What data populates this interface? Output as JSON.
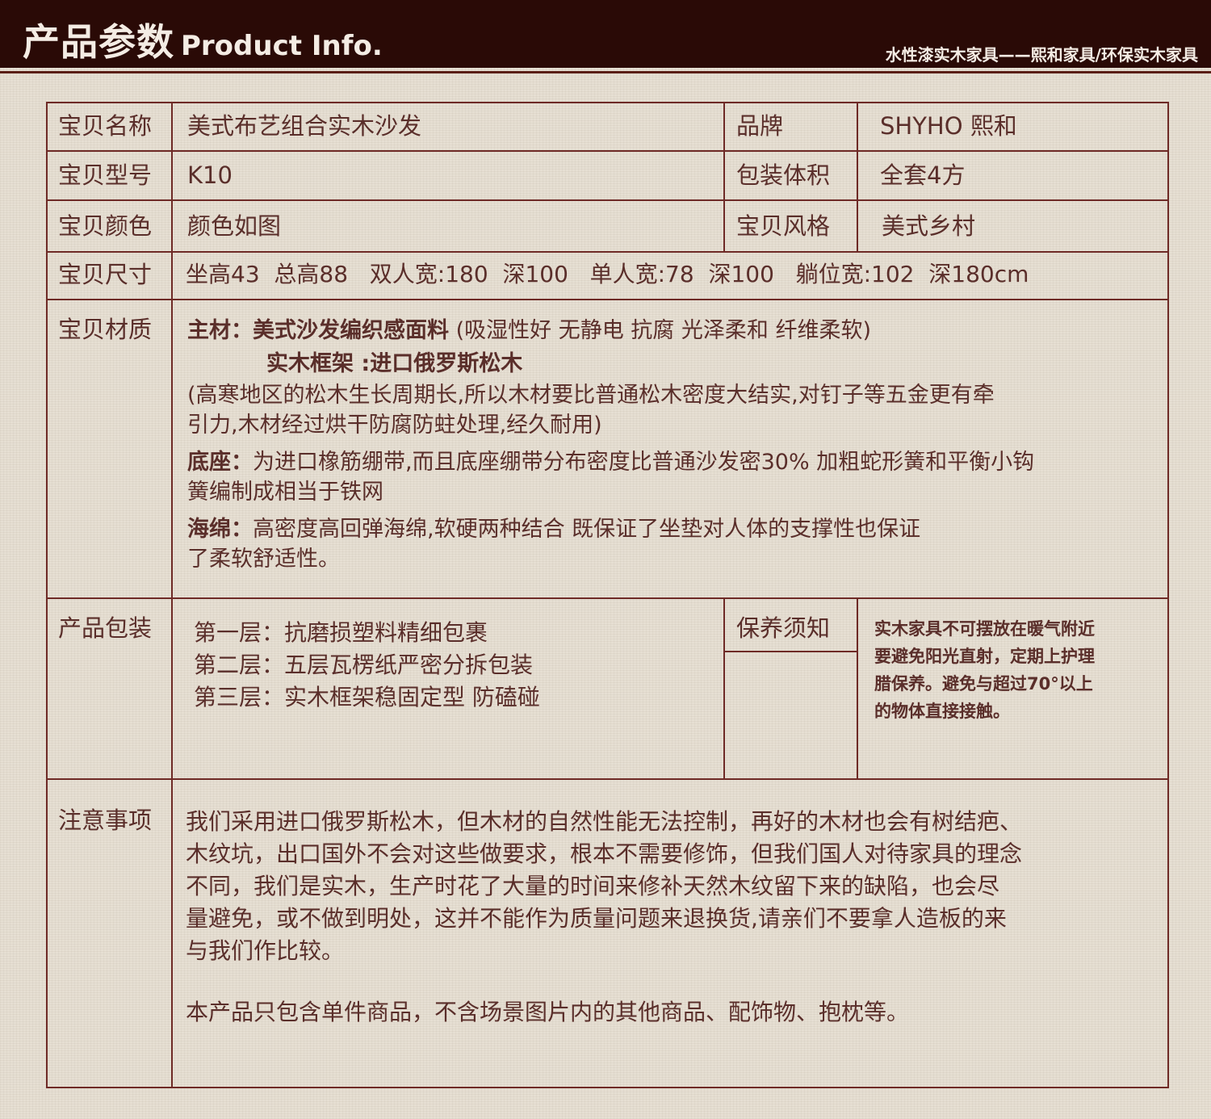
{
  "header": {
    "title_cn": "产品参数",
    "title_en": "Product Info.",
    "slogan": "水性漆实木家具——熙和家具/环保实木家具"
  },
  "rows": {
    "name": {
      "label": "宝贝名称",
      "value": "美式布艺组合实木沙发"
    },
    "brand": {
      "label": "品牌",
      "value": "SHYHO 熙和"
    },
    "model": {
      "label": "宝贝型号",
      "value": "K10"
    },
    "volume": {
      "label": "包装体积",
      "value": "全套4方"
    },
    "color": {
      "label": "宝贝颜色",
      "value": "颜色如图"
    },
    "style": {
      "label": "宝贝风格",
      "value": "美式乡村"
    },
    "size": {
      "label": "宝贝尺寸",
      "value": "坐高43  总高88   双人宽:180  深100   单人宽:78  深100   躺位宽:102  深180cm"
    },
    "material": {
      "label": "宝贝材质",
      "main_title": "主材：美式沙发编织感面料",
      "main_desc": " (吸湿性好 无静电 抗腐 光泽柔和 纤维柔软)",
      "frame_title": "实木框架 :进口俄罗斯松木",
      "frame_desc_1": "(高寒地区的松木生长周期长,所以木材要比普通松木密度大结实,对钉子等五金更有牵",
      "frame_desc_2": "引力,木材经过烘干防腐防蛀处理,经久耐用)",
      "base_title": "底座：",
      "base_desc_1": "为进口橡筋绷带,而且底座绷带分布密度比普通沙发密30% 加粗蛇形簧和平衡小钩",
      "base_desc_2": "簧编制成相当于铁网",
      "sponge_title": "海绵：",
      "sponge_desc_1": "高密度高回弹海绵,软硬两种结合 既保证了坐垫对人体的支撑性也保证",
      "sponge_desc_2": "了柔软舒适性。"
    },
    "package": {
      "label": "产品包装",
      "lines": [
        "第一层：抗磨损塑料精细包裹",
        "第二层：五层瓦楞纸严密分拆包装",
        "第三层：实木框架稳固定型 防磕碰"
      ]
    },
    "care": {
      "label": "保养须知",
      "lines": [
        "实木家具不可摆放在暖气附近",
        "要避免阳光直射，定期上护理",
        "腊保养。避免与超过70°以上",
        "的物体直接接触。"
      ]
    },
    "notice": {
      "label": "注意事项",
      "lines": [
        "我们采用进口俄罗斯松木，但木材的自然性能无法控制，再好的木材也会有树结疤、",
        "木纹坑，出口国外不会对这些做要求，根本不需要修饰，但我们国人对待家具的理念",
        "不同，我们是实木，生产时花了大量的时间来修补天然木纹留下来的缺陷，也会尽",
        "量避免，或不做到明处，这并不能作为质量问题来退换货,请亲们不要拿人造板的来",
        "与我们作比较。"
      ],
      "extra": "本产品只包含单件商品，不含场景图片内的其他商品、配饰物、抱枕等。"
    }
  },
  "colors": {
    "header_bg": "#2a0a06",
    "border": "#6e2a26",
    "text": "#5a2e2a",
    "paper": "#e6dfd3"
  }
}
